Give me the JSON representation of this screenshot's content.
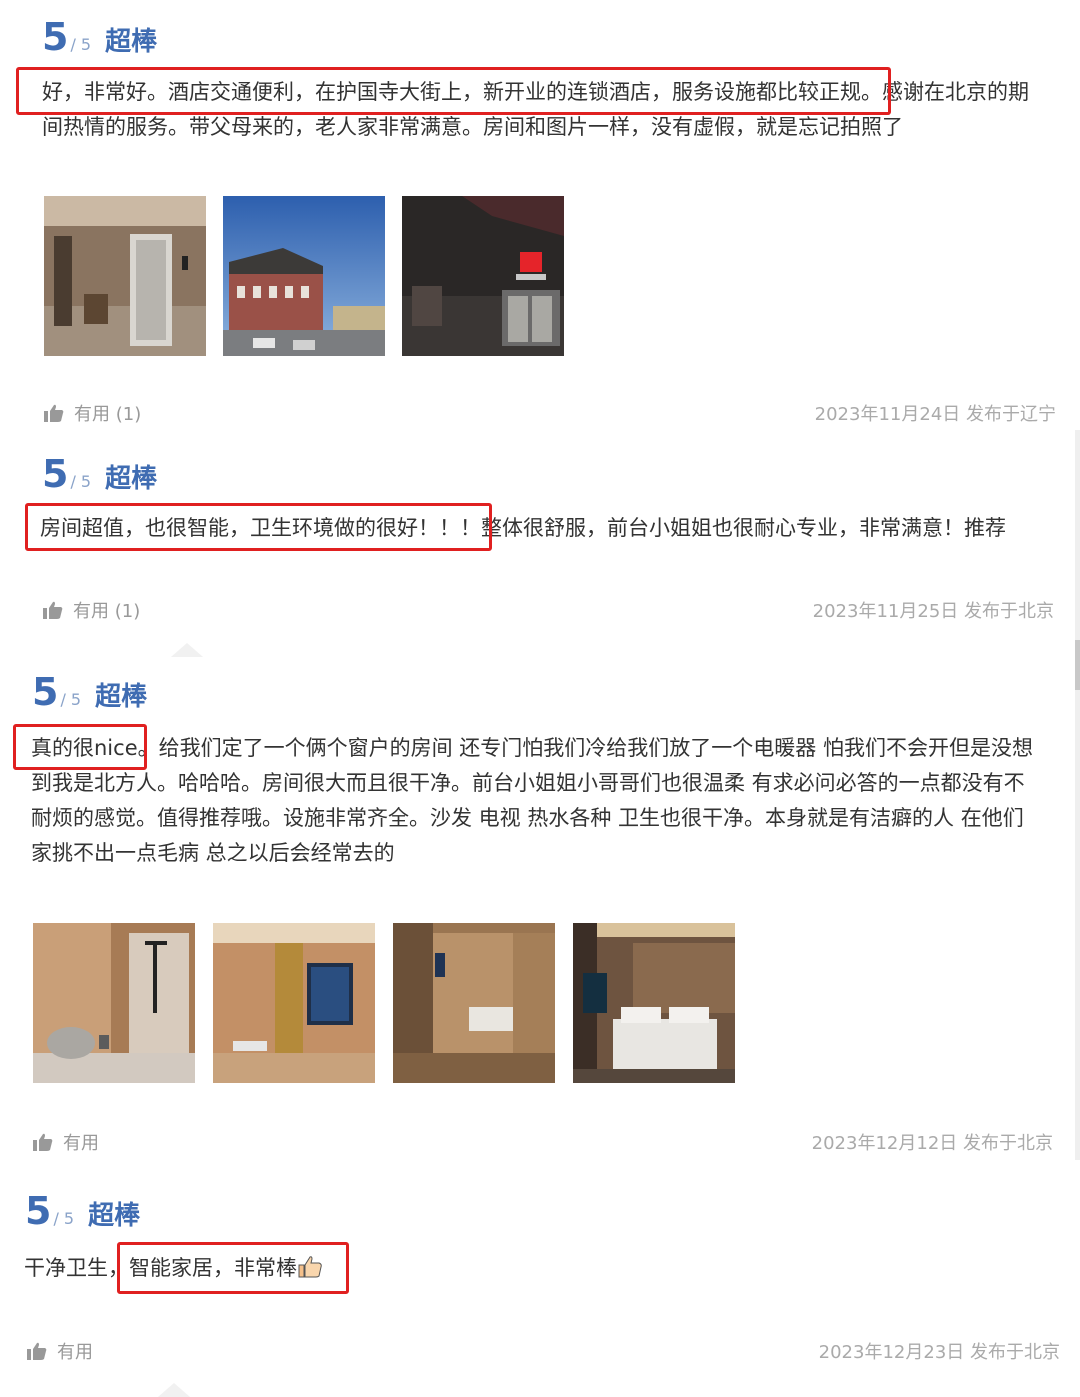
{
  "reviews": [
    {
      "score": "5",
      "score_max": "/ 5",
      "rating_text": "超棒",
      "lines": [
        "好，非常好。酒店交通便利，在护国寺大街上，新开业的连锁酒店，服务设施都比较正规。感谢在北京的期",
        "间热情的服务。带父母来的，老人家非常满意。房间和图片一样，没有虚假，就是忘记拍照了"
      ],
      "photos": [
        "hallway-elevator-photo",
        "historic-building-photo",
        "hotel-entrance-night-photo"
      ],
      "useful_label": "有用 (1)",
      "date": "2023年11月24日 发布于辽宁"
    },
    {
      "score": "5",
      "score_max": "/ 5",
      "rating_text": "超棒",
      "lines": [
        "房间超值，也很智能，卫生环境做的很好！！！整体很舒服，前台小姐姐也很耐心专业，非常满意！推荐"
      ],
      "photos": [],
      "useful_label": "有用 (1)",
      "date": "2023年11月25日 发布于北京"
    },
    {
      "score": "5",
      "score_max": "/ 5",
      "rating_text": "超棒",
      "lines": [
        "真的很nice。给我们定了一个俩个窗户的房间 还专门怕我们冷给我们放了一个电暖器 怕我们不会开但是没想",
        "到我是北方人。哈哈哈。房间很大而且很干净。前台小姐姐小哥哥们也很温柔 有求必问必答的一点都没有不",
        "耐烦的感觉。值得推荐哦。设施非常齐全。沙发 电视 热水各种 卫生也很干净。本身就是有洁癖的人 在他们",
        "家挑不出一点毛病 总之以后会经常去的"
      ],
      "photos": [
        "bathroom-shower-photo",
        "room-tv-photo",
        "room-corridor-photo",
        "bedroom-photo"
      ],
      "useful_label": "有用",
      "date": "2023年12月12日 发布于北京"
    },
    {
      "score": "5",
      "score_max": "/ 5",
      "rating_text": "超棒",
      "lines": [
        "干净卫生，智能家居，非常棒"
      ],
      "photos": [],
      "useful_label": "有用",
      "date": "2023年12月23日 发布于北京"
    }
  ],
  "colors": {
    "score_blue": "#3f6cb2",
    "highlight_red": "#e02020",
    "meta_gray": "#aaaaaa"
  },
  "icons": [
    "thumbs-up-icon",
    "thumbs-up-emoji-icon"
  ]
}
